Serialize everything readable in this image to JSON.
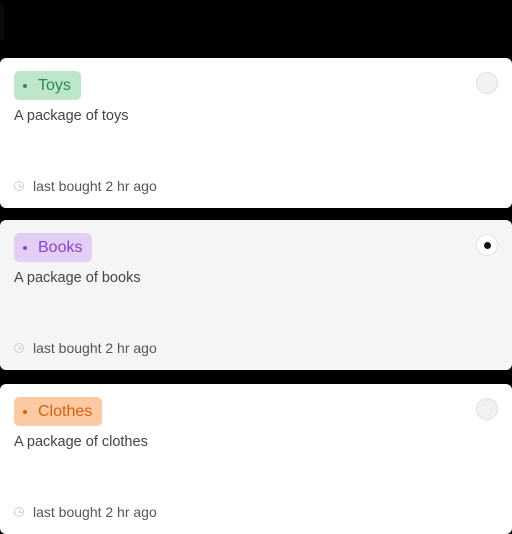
{
  "header": {
    "title": "",
    "background_color": "#000000"
  },
  "items": [
    {
      "tag": "Toys",
      "tag_bg": "#bde6cb",
      "tag_color": "#2e8a50",
      "dot_color": "#2e8a50",
      "description": "A package of toys",
      "meta_icon": "clock-icon",
      "meta": "last bought 2 hr ago",
      "selected": false
    },
    {
      "tag": "Books",
      "tag_bg": "#e3cff6",
      "tag_color": "#8a44c4",
      "dot_color": "#8a44c4",
      "description": "A package of books",
      "meta_icon": "clock-icon",
      "meta": "last bought 2 hr ago",
      "selected": true
    },
    {
      "tag": "Clothes",
      "tag_bg": "#fdc9a2",
      "tag_color": "#d3620f",
      "dot_color": "#d3620f",
      "description": "A package of clothes",
      "meta_icon": "clock-icon",
      "meta": "last bought 2 hr ago",
      "selected": false
    }
  ]
}
